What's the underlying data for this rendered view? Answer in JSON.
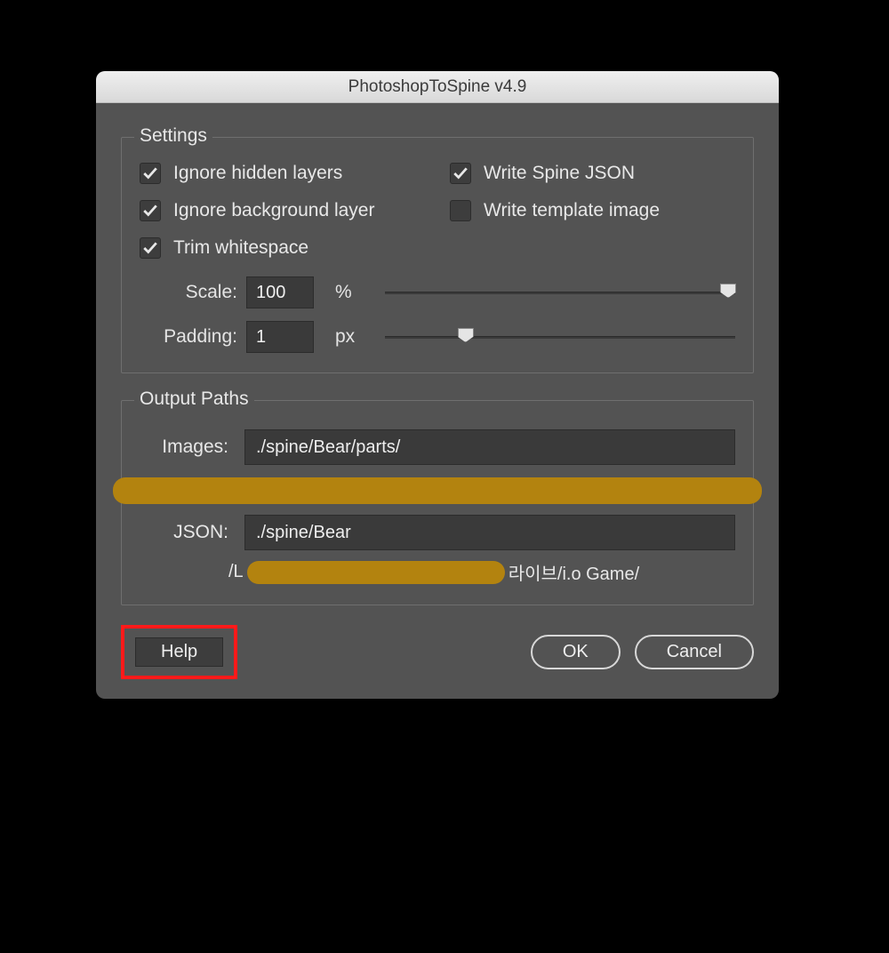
{
  "window": {
    "title": "PhotoshopToSpine v4.9"
  },
  "settings": {
    "legend": "Settings",
    "checks": {
      "ignore_hidden": {
        "label": "Ignore hidden layers",
        "checked": true
      },
      "write_json": {
        "label": "Write Spine JSON",
        "checked": true
      },
      "ignore_bg": {
        "label": "Ignore background layer",
        "checked": true
      },
      "write_template": {
        "label": "Write template image",
        "checked": false
      },
      "trim": {
        "label": "Trim whitespace",
        "checked": true
      }
    },
    "scale": {
      "label": "Scale:",
      "value": "100",
      "unit": "%",
      "thumb_pct": 98
    },
    "padding": {
      "label": "Padding:",
      "value": "1",
      "unit": "px",
      "thumb_pct": 23
    }
  },
  "output": {
    "legend": "Output Paths",
    "images": {
      "label": "Images:",
      "value": "./spine/Bear/parts/"
    },
    "json": {
      "label": "JSON:",
      "value": "./spine/Bear"
    },
    "hint_prefix": "/L",
    "hint_suffix": "라이브/i.o Game/"
  },
  "buttons": {
    "help": "Help",
    "ok": "OK",
    "cancel": "Cancel"
  }
}
